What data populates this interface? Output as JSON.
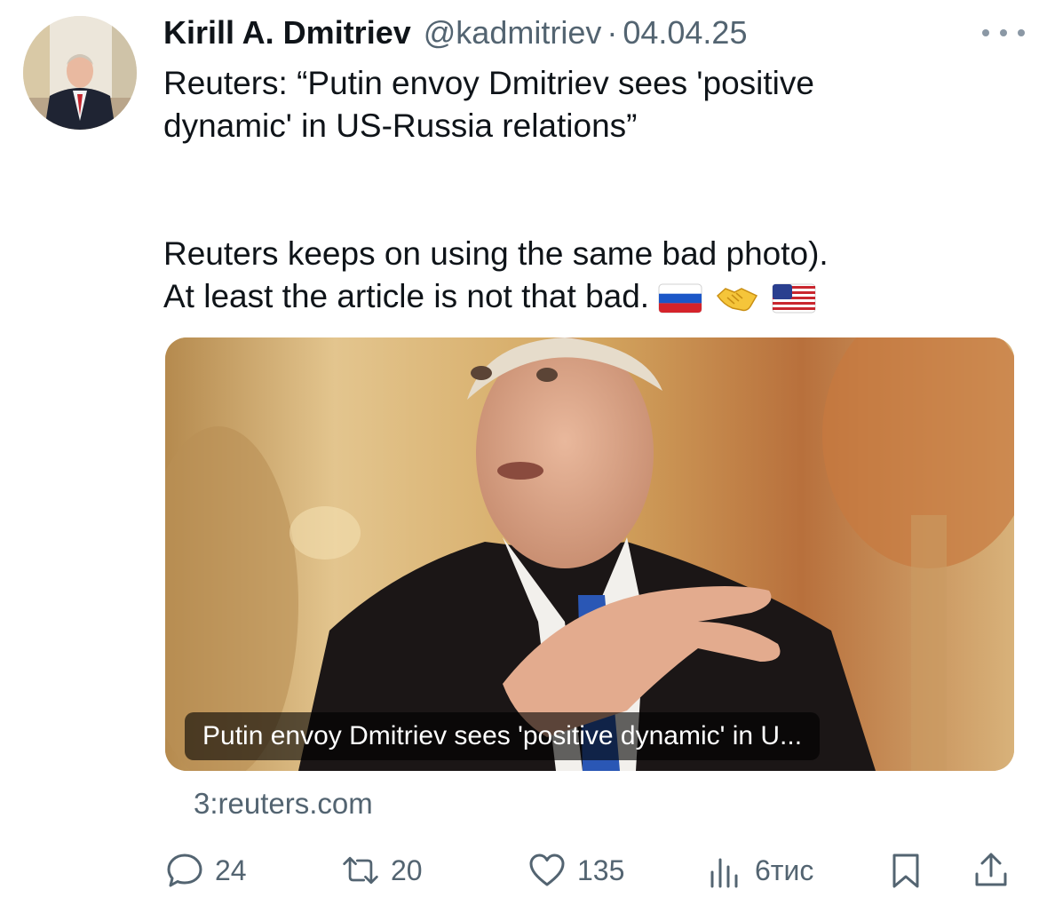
{
  "tweet": {
    "author_name": "Kirill A. Dmitriev",
    "handle": "@kadmitriev",
    "separator": "·",
    "date": "04.04.25",
    "text_line1": "Reuters: “Putin envoy Dmitriev sees 'positive",
    "text_line2": "dynamic' in US-Russia relations”",
    "text_line3": "Reuters keeps on using the same bad photo).",
    "text_line4": "At least the article is not that bad."
  },
  "link_card": {
    "caption": "Putin envoy Dmitriev sees 'positive dynamic' in U...",
    "domain": "3:reuters.com"
  },
  "actions": {
    "replies": "24",
    "reposts": "20",
    "likes": "135",
    "views": "6тис"
  },
  "icons": {
    "more": "more-horizontal-icon",
    "reply": "reply-icon",
    "repost": "repost-icon",
    "like": "heart-icon",
    "views": "views-icon",
    "bookmark": "bookmark-icon",
    "share": "share-icon",
    "flags": [
      "russia-flag-icon",
      "handshake-icon",
      "usa-flag-icon"
    ]
  },
  "colors": {
    "primary_text": "#0f1419",
    "secondary_text": "#536471"
  }
}
